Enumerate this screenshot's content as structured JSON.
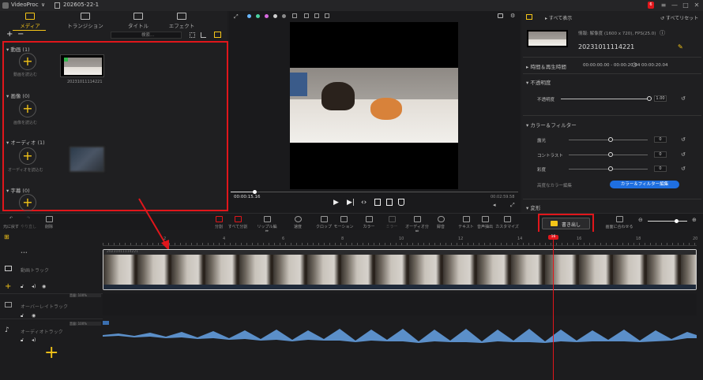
{
  "titlebar": {
    "app": "VideoProc",
    "project": "202605-22-1",
    "notif_count": "6",
    "minimize": "—",
    "maximize": "□",
    "close": "✕"
  },
  "left_tabs": [
    {
      "label": "メディア",
      "icon": "media-icon"
    },
    {
      "label": "トランジション",
      "icon": "transition-icon"
    },
    {
      "label": "タイトル",
      "icon": "title-icon"
    },
    {
      "label": "エフェクト",
      "icon": "effect-icon"
    }
  ],
  "media_toolbar": {
    "add": "+",
    "remove": "−",
    "search_placeholder": "検索..."
  },
  "media": {
    "video": {
      "header": "動画 (1)",
      "import": "動画を読込む",
      "clip_name": "20231011114221"
    },
    "image": {
      "header": "画像 (0)",
      "import": "画像を読込む"
    },
    "audio": {
      "header": "オーディオ (1)",
      "import": "オーディオを読込む"
    },
    "subtitle": {
      "header": "字幕 (0)"
    }
  },
  "preview": {
    "current_time": "00:00:15.16",
    "total_time": "00:02:59.58"
  },
  "right_panel": {
    "show_all": "すべて表示",
    "reset_all": "すべてリセット",
    "info": "情報: 解像度 (1600 x 720), FPS(25.0)",
    "clip_name": "20231011114221",
    "time_header": "時間＆再生時間",
    "time_start": "00:00:00.00 - 00:00:20.04",
    "duration": "00:00:20.04",
    "opacity_header": "不透明度",
    "opacity_label": "不透明度",
    "opacity_value": "1.00",
    "opacity_level": 1.0,
    "color_header": "カラー＆フィルター",
    "brightness_label": "露光",
    "brightness_value": "0",
    "contrast_label": "コントラスト",
    "contrast_value": "0",
    "saturation_label": "彩度",
    "saturation_value": "0",
    "advanced_label": "高度なカラー編集",
    "color_filter_btn": "カラー＆フィルター編集",
    "transform_header": "変形"
  },
  "toolbar": {
    "undo": "元に戻す",
    "redo": "やり直し",
    "delete": "削除",
    "tools": [
      "分割",
      "すべて分割",
      "リップル編集",
      "速度",
      "クロップ",
      "モーション",
      "カラー",
      "ミラー",
      "オーディオ分離",
      "録音",
      "テキスト",
      "音声抽出",
      "カスタマイズ"
    ],
    "export": "書き出し",
    "fit": "画面に合わせる"
  },
  "timeline": {
    "ticks": [
      "2",
      "4",
      "6",
      "8",
      "10",
      "12",
      "14",
      "16",
      "18",
      "20"
    ],
    "playhead_label": "16",
    "video_track": "動画トラック",
    "overlay_track": "オーバーレイトラック",
    "audio_track": "オーディオトラック",
    "clip_label": "20231011114221",
    "volume_label": "音量: 100%"
  },
  "colors": {
    "accent": "#f5c518",
    "highlight": "#e0161b",
    "audio_wave": "#5b8fc9",
    "blue_button": "#1f6fe0"
  }
}
